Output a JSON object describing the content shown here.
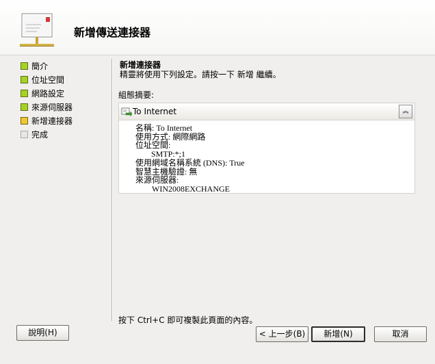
{
  "wizard": {
    "title": "新增傳送連接器",
    "icon": "send-connector-wizard-icon"
  },
  "nav": {
    "items": [
      {
        "label": "簡介",
        "status": "complete"
      },
      {
        "label": "位址空間",
        "status": "complete"
      },
      {
        "label": "網路設定",
        "status": "complete"
      },
      {
        "label": "來源伺服器",
        "status": "complete"
      },
      {
        "label": "新增連接器",
        "status": "current"
      },
      {
        "label": "完成",
        "status": "pending"
      }
    ]
  },
  "page": {
    "title": "新增連接器",
    "instruction": "精靈將使用下列設定。請按一下 新增 繼續。",
    "summary_label": "組態摘要:"
  },
  "summary": {
    "name": "To Internet",
    "lines": {
      "name": "名稱: To Internet",
      "usage": "使用方式: 網際網路",
      "address_space_label": "位址空間:",
      "address_space_value": "SMTP:*;1",
      "dns": "使用網域名稱系統 (DNS): True",
      "smarthost_auth": "智慧主機驗證: 無",
      "source_server_label": "來源伺服器:",
      "source_server_value": "WIN2008EXCHANGE"
    },
    "collapse_icon": "double-chevron-up-icon"
  },
  "footer": {
    "copy_hint": "按下 Ctrl+C 即可複製此頁面的內容。",
    "help_label": "說明(H)",
    "back_label": "< 上一步(B)",
    "new_label": "新增(N)",
    "cancel_label": "取消"
  },
  "colors": {
    "background": "#f0efed",
    "step_complete": "#a5d321",
    "step_current": "#f0c633",
    "step_pending": "#e6e6e6"
  }
}
